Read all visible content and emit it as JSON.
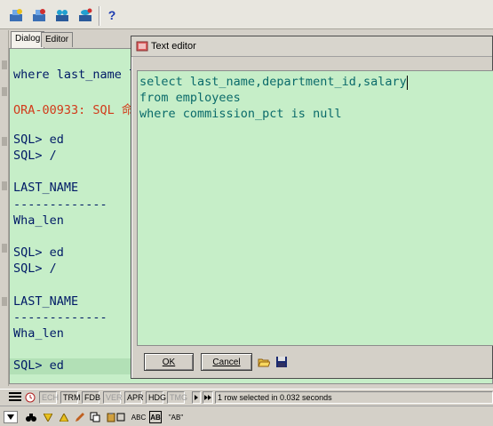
{
  "tabs": [
    {
      "label": "Dialog",
      "active": true
    },
    {
      "label": "Editor",
      "active": false
    }
  ],
  "output_lines": [
    {
      "text": "where last_name l",
      "type": "normal"
    },
    {
      "text": "",
      "type": "normal"
    },
    {
      "text": "ORA-00933: SQL 命",
      "type": "error"
    },
    {
      "text": "",
      "type": "normal"
    },
    {
      "text": "SQL> ed",
      "type": "normal"
    },
    {
      "text": "SQL> /",
      "type": "normal"
    },
    {
      "text": "",
      "type": "normal"
    },
    {
      "text": "LAST_NAME",
      "type": "normal"
    },
    {
      "text": "-------------",
      "type": "normal"
    },
    {
      "text": "Wha_len",
      "type": "normal"
    },
    {
      "text": "",
      "type": "normal"
    },
    {
      "text": "SQL> ed",
      "type": "normal"
    },
    {
      "text": "SQL> /",
      "type": "normal"
    },
    {
      "text": "",
      "type": "normal"
    },
    {
      "text": "LAST_NAME",
      "type": "normal"
    },
    {
      "text": "-------------",
      "type": "normal"
    },
    {
      "text": "Wha_len",
      "type": "normal"
    },
    {
      "text": "",
      "type": "normal"
    },
    {
      "text": "SQL> ed",
      "type": "current"
    }
  ],
  "editor": {
    "title": "Text editor",
    "lines": [
      "select last_name,department_id,salary",
      "from employees",
      "where commission_pct is null"
    ],
    "ok_label": "OK",
    "cancel_label": "Cancel"
  },
  "status": {
    "cells": [
      {
        "label": "ECH",
        "enabled": false
      },
      {
        "label": "TRM",
        "enabled": true
      },
      {
        "label": "FDB",
        "enabled": true
      },
      {
        "label": "VER",
        "enabled": false
      },
      {
        "label": "APR",
        "enabled": true
      },
      {
        "label": "HDG",
        "enabled": true
      },
      {
        "label": "TMG",
        "enabled": false
      }
    ],
    "message": "1 row selected in 0.032 seconds"
  },
  "bottom_toolbar": {
    "abc_label": "ABC",
    "ab_label": "AB",
    "ab_quote_label": "\"AB\""
  },
  "colors": {
    "output_bg": "#c6eec8",
    "error_text": "#d23a1a",
    "editor_text": "#0a6a6a"
  },
  "icons": [
    "connect-icon",
    "disconnect-icon",
    "users-icon",
    "database-icon",
    "help-icon"
  ]
}
